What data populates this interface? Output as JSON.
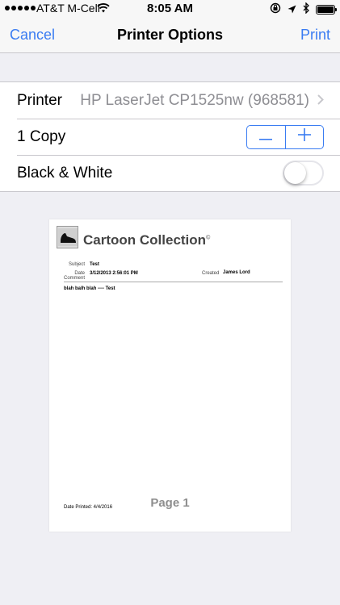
{
  "status_bar": {
    "carrier": "AT&T M-Cell",
    "time": "8:05 AM",
    "icons": [
      "signal-dots-icon",
      "wifi-icon",
      "lock-rotation-icon",
      "location-arrow-icon",
      "bluetooth-icon",
      "battery-icon"
    ]
  },
  "nav": {
    "cancel_label": "Cancel",
    "title": "Printer Options",
    "print_label": "Print"
  },
  "options": {
    "printer_label": "Printer",
    "printer_value": "HP LaserJet CP1525nw (968581)",
    "copies_label": "1 Copy",
    "minus_symbol": "—",
    "plus_symbol": "+",
    "bw_label": "Black & White",
    "bw_enabled": false
  },
  "preview": {
    "title": "Cartoon Collection",
    "title_mark": "©",
    "subject_label": "Subject",
    "subject_value": "Test",
    "date_label": "Date",
    "date_value": "3/12/2013 2:56:01 PM",
    "created_label": "Created",
    "created_value": "James Lord",
    "comment_label": "Comment",
    "comment_text": "blah balh blah ---- Test",
    "date_printed": "Date Printed: 4/4/2016",
    "page_label": "Page 1"
  },
  "colors": {
    "accent": "#3a7cf2",
    "nav_background": "#f7f7f7",
    "page_background": "#efeff4",
    "secondary_text": "#8e8e93"
  }
}
